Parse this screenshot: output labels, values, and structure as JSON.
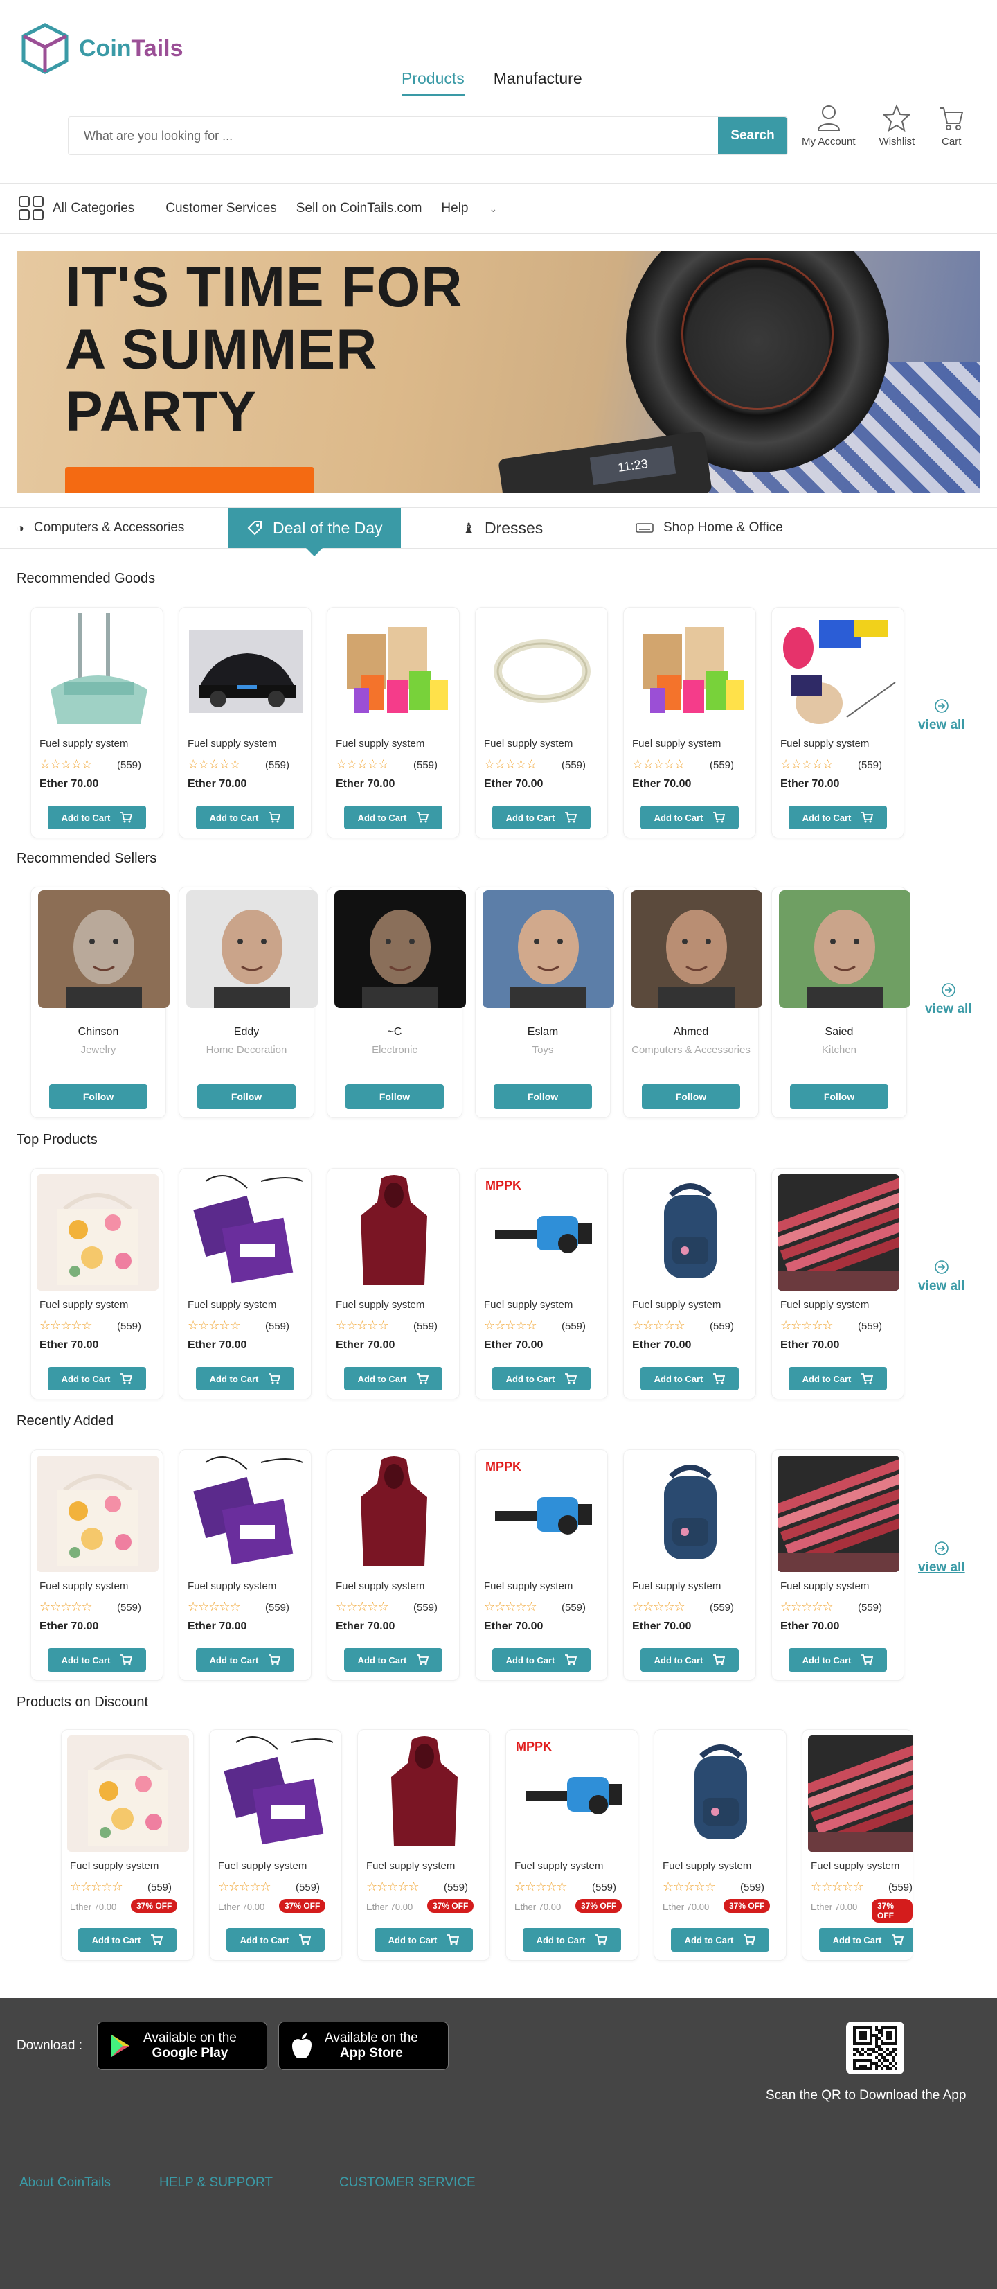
{
  "brand": {
    "part1": "Coin",
    "part2": "Tails"
  },
  "header": {
    "tabs": [
      {
        "label": "Products",
        "active": true
      },
      {
        "label": "Manufacture",
        "active": false
      }
    ],
    "search": {
      "placeholder": "What are you looking for ...",
      "value": "",
      "button": "Search"
    },
    "actions": [
      {
        "label": "My Account",
        "icon": "user-icon"
      },
      {
        "label": "Wishlist",
        "icon": "star-icon"
      },
      {
        "label": "Cart",
        "icon": "cart-icon"
      }
    ]
  },
  "nav": {
    "all_categories": "All Categories",
    "items": [
      "Customer Services",
      "Sell on CoinTails.com",
      "Help"
    ]
  },
  "banner": {
    "line1": "IT'S TIME FOR",
    "line2": "A SUMMER",
    "line3": "PARTY",
    "device_time": "11:23"
  },
  "category_tabs": [
    {
      "label": "Computers & Accessories",
      "icon": "mouse-icon",
      "active": false
    },
    {
      "label": "Deal of the Day",
      "icon": "tag-icon",
      "active": true
    },
    {
      "label": "Dresses",
      "icon": "dress-icon",
      "active": false
    },
    {
      "label": "Shop Home & Office",
      "icon": "keyboard-icon",
      "active": false
    }
  ],
  "common": {
    "add_to_cart": "Add to Cart",
    "view_all": "view all",
    "follow": "Follow",
    "rating_stars": "☆☆☆☆☆",
    "reviews": "(559)",
    "price": "Ether 70.00",
    "old_price": "Ether 70.00",
    "discount": "37% OFF"
  },
  "sections": {
    "recommended_goods": {
      "title": "Recommended Goods",
      "items": [
        {
          "name": "Fuel supply system",
          "image": "broom-dustpan"
        },
        {
          "name": "Fuel supply system",
          "image": "black-car"
        },
        {
          "name": "Fuel supply system",
          "image": "paper-bags"
        },
        {
          "name": "Fuel supply system",
          "image": "ring-bracelet"
        },
        {
          "name": "Fuel supply system",
          "image": "paper-bags"
        },
        {
          "name": "Fuel supply system",
          "image": "fans-craft"
        }
      ]
    },
    "recommended_sellers": {
      "title": "Recommended Sellers",
      "items": [
        {
          "name": "Chinson",
          "category": "Jewelry"
        },
        {
          "name": "Eddy",
          "category": "Home Decoration"
        },
        {
          "name": "~C",
          "category": "Electronic"
        },
        {
          "name": "Eslam",
          "category": "Toys"
        },
        {
          "name": "Ahmed",
          "category": "Computers & Accessories"
        },
        {
          "name": "Saied",
          "category": "Kitchen"
        }
      ]
    },
    "top_products": {
      "title": "Top Products",
      "items": [
        {
          "name": "Fuel supply system",
          "image": "floral-tote"
        },
        {
          "name": "Fuel supply system",
          "image": "purple-pouch"
        },
        {
          "name": "Fuel supply system",
          "image": "red-hoodie"
        },
        {
          "name": "Fuel supply system",
          "image": "blue-tool",
          "badge": "MPPK"
        },
        {
          "name": "Fuel supply system",
          "image": "navy-backpack"
        },
        {
          "name": "Fuel supply system",
          "image": "lipstick-swatches"
        }
      ]
    },
    "recently_added": {
      "title": "Recently Added",
      "items": [
        {
          "name": "Fuel supply system",
          "image": "floral-tote"
        },
        {
          "name": "Fuel supply system",
          "image": "purple-pouch"
        },
        {
          "name": "Fuel supply system",
          "image": "red-hoodie"
        },
        {
          "name": "Fuel supply system",
          "image": "blue-tool",
          "badge": "MPPK"
        },
        {
          "name": "Fuel supply system",
          "image": "navy-backpack"
        },
        {
          "name": "Fuel supply system",
          "image": "lipstick-swatches"
        }
      ]
    },
    "products_on_discount": {
      "title": "Products on Discount",
      "items": [
        {
          "name": "Fuel supply system",
          "image": "floral-tote"
        },
        {
          "name": "Fuel supply system",
          "image": "purple-pouch"
        },
        {
          "name": "Fuel supply system",
          "image": "red-hoodie"
        },
        {
          "name": "Fuel supply system",
          "image": "blue-tool",
          "badge": "MPPK"
        },
        {
          "name": "Fuel supply system",
          "image": "navy-backpack"
        },
        {
          "name": "Fuel supply system",
          "image": "lipstick-swatches"
        }
      ]
    }
  },
  "footer": {
    "download_label": "Download :",
    "google_play": {
      "line1": "Available on the",
      "line2": "Google Play"
    },
    "app_store": {
      "line1": "Available on the",
      "line2": "App Store"
    },
    "qr_text": "Scan the QR to Download the App",
    "links": [
      "About CoinTails",
      "HELP & SUPPORT",
      "CUSTOMER SERVICE"
    ]
  },
  "colors": {
    "accent": "#3a9aa6",
    "brand_purple": "#9b4f96",
    "footer_bg": "#454545",
    "discount_red": "#d41c1c",
    "star": "#f2a838"
  }
}
